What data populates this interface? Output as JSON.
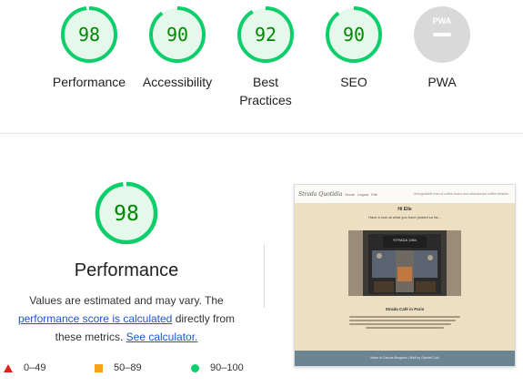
{
  "gauges": [
    {
      "score": "98",
      "label_lines": [
        "Performance"
      ]
    },
    {
      "score": "90",
      "label_lines": [
        "Accessibility"
      ]
    },
    {
      "score": "92",
      "label_lines": [
        "Best",
        "Practices"
      ]
    },
    {
      "score": "90",
      "label_lines": [
        "SEO"
      ]
    },
    {
      "score": "",
      "label_lines": [
        "PWA"
      ],
      "badge_text": "PWA"
    }
  ],
  "performance": {
    "score": "98",
    "title": "Performance",
    "desc_text_1": "Values are estimated and may vary. The",
    "link_score_calc": "performance score is calculated",
    "desc_text_2": "directly from these metrics.",
    "link_see_calc": "See calculator."
  },
  "legend": [
    {
      "range": "0–49",
      "color": "#e0231b"
    },
    {
      "range": "50–89",
      "color": "#f4a31a"
    },
    {
      "range": "90–100",
      "color": "#0cce6b"
    }
  ],
  "colors": {
    "pass_ring": "#0cce6b",
    "pass_fill": "#e6f8ec",
    "pass_text": "#008800",
    "pwa_gray": "#d9d9d9",
    "link": "#1a57c9"
  },
  "screenshot": {
    "logo": "Strada Quotidia",
    "nav": [
      "Home",
      "Logout",
      "Elle"
    ],
    "tagline": "Unforgettable lives of coffee lovers and adventurous coffee drinkers",
    "greeting": "Hi Elle",
    "subtitle": "Have a look at what you have posted so far...",
    "shop_sign": "STRADA 1984",
    "post_title": "Strada Café in Paris",
    "footer": "Made in Canvas Bergamo | Built by Gabriel Cold"
  }
}
